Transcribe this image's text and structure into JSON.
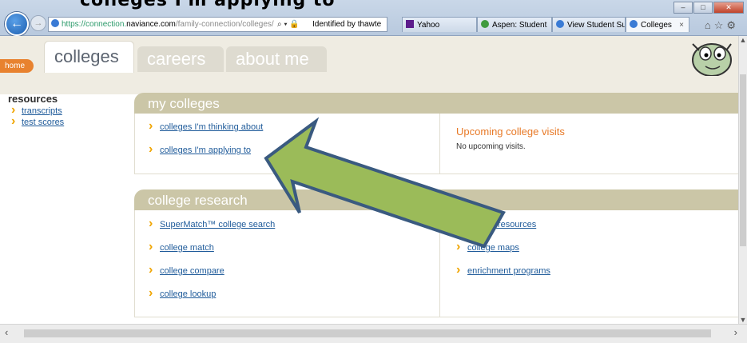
{
  "overlay_title": "colleges I'm applying to",
  "browser": {
    "back_icon": "back-arrow-icon",
    "forward_icon": "forward-arrow-icon",
    "url_scheme": "https://connection.",
    "url_host": "naviance.com",
    "url_path": "/family-connection/colleges/",
    "identity": "Identified by thawte",
    "tabs": [
      {
        "label": "Yahoo",
        "icon": "yahoo-icon"
      },
      {
        "label": "Aspen: Student",
        "icon": "aspen-icon"
      },
      {
        "label": "View Student Su...",
        "icon": "naviance-icon"
      },
      {
        "label": "Colleges",
        "icon": "naviance-icon"
      }
    ],
    "toolbar_icons": [
      "home-icon",
      "star-icon",
      "gear-icon"
    ]
  },
  "nav": {
    "home": "home",
    "tabs": [
      {
        "label": "colleges",
        "active": true
      },
      {
        "label": "careers",
        "active": false
      },
      {
        "label": "about me",
        "active": false
      }
    ]
  },
  "sidebar": {
    "title": "resources",
    "links": [
      "transcripts",
      "test scores"
    ]
  },
  "my_colleges": {
    "title": "my colleges",
    "links": [
      "colleges I'm thinking about",
      "colleges I'm applying to"
    ],
    "visits_title": "Upcoming college visits",
    "visits_text": "No upcoming visits."
  },
  "college_research": {
    "title": "college research",
    "left_links": [
      "SuperMatch™ college search",
      "college match",
      "college compare",
      "college lookup"
    ],
    "right_links": [
      "college resources",
      "college maps",
      "enrichment programs"
    ]
  },
  "colors": {
    "accent_orange": "#e8822f",
    "panel_header": "#cbc6a7",
    "link_blue": "#1f5b9a",
    "arrow_green": "#9bbb59",
    "arrow_outline": "#3a5a80"
  }
}
